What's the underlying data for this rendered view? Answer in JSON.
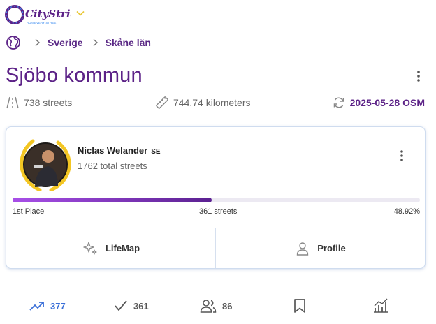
{
  "app": {
    "logo_text": "CityStrides",
    "logo_tagline": "RUN EVERY STREET"
  },
  "breadcrumb": {
    "items": [
      "Sverige",
      "Skåne län"
    ]
  },
  "page": {
    "title": "Sjöbo kommun"
  },
  "stats": {
    "streets": "738 streets",
    "distance": "744.74 kilometers",
    "osm_update": "2025-05-28 OSM"
  },
  "leader": {
    "name": "Niclas Welander",
    "country_code": "SE",
    "total_streets": "1762 total streets",
    "progress_fraction": 0.4892,
    "place": "1st Place",
    "streets_completed": "361 streets",
    "percent": "48.92%"
  },
  "card_actions": {
    "lifemap": "LifeMap",
    "profile": "Profile"
  },
  "bottom_bar": {
    "trending": "377",
    "completed": "361",
    "people": "86"
  },
  "colors": {
    "brand_purple": "#5c2287",
    "progress_start": "#a84fe8",
    "progress_end": "#5b2191",
    "active_blue": "#3a6fd8",
    "laurel_yellow": "#f3c623"
  }
}
